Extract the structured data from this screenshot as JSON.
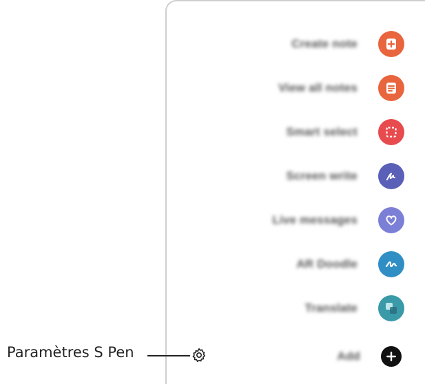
{
  "callout": {
    "label": "Paramètres S Pen"
  },
  "menu": {
    "items": [
      {
        "label": "Create note",
        "icon": "create-note-icon",
        "color": "#e8653d"
      },
      {
        "label": "View all notes",
        "icon": "view-notes-icon",
        "color": "#e8653d"
      },
      {
        "label": "Smart select",
        "icon": "smart-select-icon",
        "color": "#e84b4e"
      },
      {
        "label": "Screen write",
        "icon": "screen-write-icon",
        "color": "#5a5fb8"
      },
      {
        "label": "Live messages",
        "icon": "live-messages-icon",
        "color": "#7c7fd6"
      },
      {
        "label": "AR Doodle",
        "icon": "ar-doodle-icon",
        "color": "#2f8fc4"
      },
      {
        "label": "Translate",
        "icon": "translate-icon",
        "color": "#3a9aa8"
      },
      {
        "label": "Add",
        "icon": "add-icon",
        "color": "#111111"
      }
    ]
  }
}
